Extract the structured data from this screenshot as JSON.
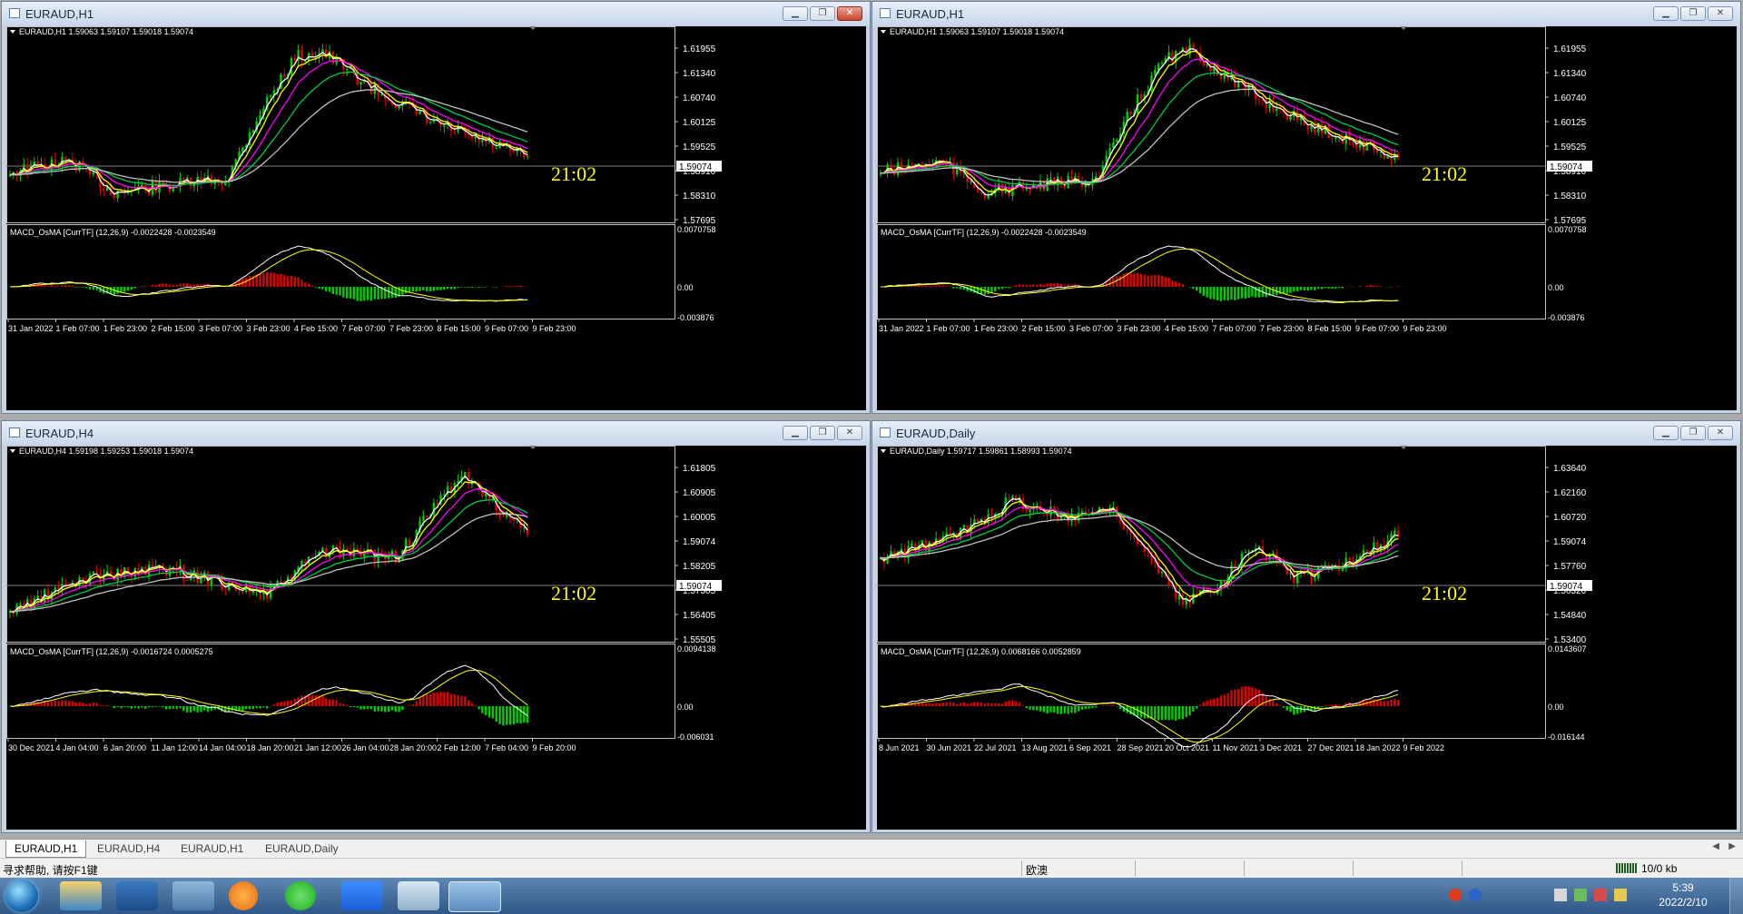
{
  "windows": [
    {
      "title": "EURAUD,H1",
      "info": "EURAUD,H1  1.59063 1.59107 1.59018 1.59074",
      "price_ticks": [
        "1.61955",
        "1.61340",
        "1.60740",
        "1.60125",
        "1.59525",
        "1.58910",
        "1.58310",
        "1.57695"
      ],
      "current_price": "1.59074",
      "clock": "21:02",
      "indicator_label": "MACD_OsMA [CurrTF] (12,26,9) -0.0022428 -0.0023549",
      "ind_ticks": [
        "0.0070758",
        "0.00",
        "-0.003876"
      ],
      "dates": [
        "31 Jan 2022",
        "1 Feb 07:00",
        "1 Feb 23:00",
        "2 Feb 15:00",
        "3 Feb 07:00",
        "3 Feb 23:00",
        "4 Feb 15:00",
        "7 Feb 07:00",
        "7 Feb 23:00",
        "8 Feb 15:00",
        "9 Feb 07:00",
        "9 Feb 23:00"
      ],
      "active": true
    },
    {
      "title": "EURAUD,H1",
      "info": "EURAUD,H1  1.59063 1.59107 1.59018 1.59074",
      "price_ticks": [
        "1.61955",
        "1.61340",
        "1.60740",
        "1.60125",
        "1.59525",
        "1.58910",
        "1.58310",
        "1.57695"
      ],
      "current_price": "1.59074",
      "clock": "21:02",
      "indicator_label": "MACD_OsMA [CurrTF] (12,26,9) -0.0022428 -0.0023549",
      "ind_ticks": [
        "0.0070758",
        "0.00",
        "-0.003876"
      ],
      "dates": [
        "31 Jan 2022",
        "1 Feb 07:00",
        "1 Feb 23:00",
        "2 Feb 15:00",
        "3 Feb 07:00",
        "3 Feb 23:00",
        "4 Feb 15:00",
        "7 Feb 07:00",
        "7 Feb 23:00",
        "8 Feb 15:00",
        "9 Feb 07:00",
        "9 Feb 23:00"
      ],
      "active": false
    },
    {
      "title": "EURAUD,H4",
      "info": "EURAUD,H4  1.59198 1.59253 1.59018 1.59074",
      "price_ticks": [
        "1.61805",
        "1.60905",
        "1.60005",
        "1.59074",
        "1.58205",
        "1.57305",
        "1.56405",
        "1.55505"
      ],
      "current_price": "1.59074",
      "clock": "21:02",
      "indicator_label": "MACD_OsMA [CurrTF] (12,26,9) -0.0016724 0.0005275",
      "ind_ticks": [
        "0.0094138",
        "0.00",
        "-0.006031"
      ],
      "dates": [
        "30 Dec 2021",
        "4 Jan 04:00",
        "6 Jan 20:00",
        "11 Jan 12:00",
        "14 Jan 04:00",
        "18 Jan 20:00",
        "21 Jan 12:00",
        "26 Jan 04:00",
        "28 Jan 20:00",
        "2 Feb 12:00",
        "7 Feb 04:00",
        "9 Feb 20:00"
      ],
      "active": false
    },
    {
      "title": "EURAUD,Daily",
      "info": "EURAUD,Daily  1.59717 1.59861 1.58993 1.59074",
      "price_ticks": [
        "1.63640",
        "1.62160",
        "1.60720",
        "1.59074",
        "1.57760",
        "1.56320",
        "1.54840",
        "1.53400"
      ],
      "current_price": "1.59074",
      "clock": "21:02",
      "indicator_label": "MACD_OsMA [CurrTF] (12,26,9) 0.0068166 0.0052859",
      "ind_ticks": [
        "0.0143607",
        "0.00",
        "-0.016144"
      ],
      "dates": [
        "8 Jun 2021",
        "30 Jun 2021",
        "22 Jul 2021",
        "13 Aug 2021",
        "6 Sep 2021",
        "28 Sep 2021",
        "20 Oct 2021",
        "11 Nov 2021",
        "3 Dec 2021",
        "27 Dec 2021",
        "18 Jan 2022",
        "9 Feb 2022"
      ],
      "active": false
    }
  ],
  "tabs": [
    "EURAUD,H1",
    "EURAUD,H4",
    "EURAUD,H1",
    "EURAUD,Daily"
  ],
  "status": {
    "help": "寻求帮助, 请按F1键",
    "profile": "欧澳",
    "connection": "10/0 kb"
  },
  "taskbar": {
    "time": "5:39",
    "date": "2022/2/10"
  },
  "colors": {
    "bull": "#00d000",
    "bear": "#e00000",
    "ma_white": "#ffffff",
    "ma_yellow": "#ffff00",
    "ma_magenta": "#ff00ff",
    "ma_green": "#00cc44",
    "ma_gray": "#c0c0c0",
    "clock": "#ffff00"
  }
}
